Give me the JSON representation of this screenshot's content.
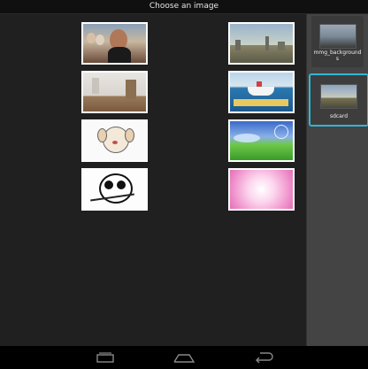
{
  "window": {
    "title": "Choose an image"
  },
  "grid": {
    "items": [
      {
        "name": "photo-crowd-woman",
        "icon": "crowd-photo"
      },
      {
        "name": "photo-city-skyline",
        "icon": "city-photo"
      },
      {
        "name": "photo-empty-room",
        "icon": "room-photo"
      },
      {
        "name": "photo-boats-water",
        "icon": "boats-photo"
      },
      {
        "name": "photo-cartoon-dog",
        "icon": "dog-drawing"
      },
      {
        "name": "photo-green-meadow",
        "icon": "meadow-photo"
      },
      {
        "name": "photo-panda-sketch",
        "icon": "panda-sketch"
      },
      {
        "name": "photo-pink-abstract",
        "icon": "pink-abstract"
      }
    ]
  },
  "folders": [
    {
      "label": "mmg_backgrounds",
      "icon": "folder-thumbnail"
    },
    {
      "label": "sdcard",
      "icon": "folder-thumbnail",
      "selected": true
    }
  ],
  "navbar": {
    "buttons": [
      {
        "name": "recent-apps",
        "icon": "recent-apps-icon"
      },
      {
        "name": "home",
        "icon": "home-icon"
      },
      {
        "name": "back",
        "icon": "back-icon"
      }
    ]
  },
  "colors": {
    "accent": "#30b7d6",
    "panel": "#444444",
    "background": "#202020"
  }
}
